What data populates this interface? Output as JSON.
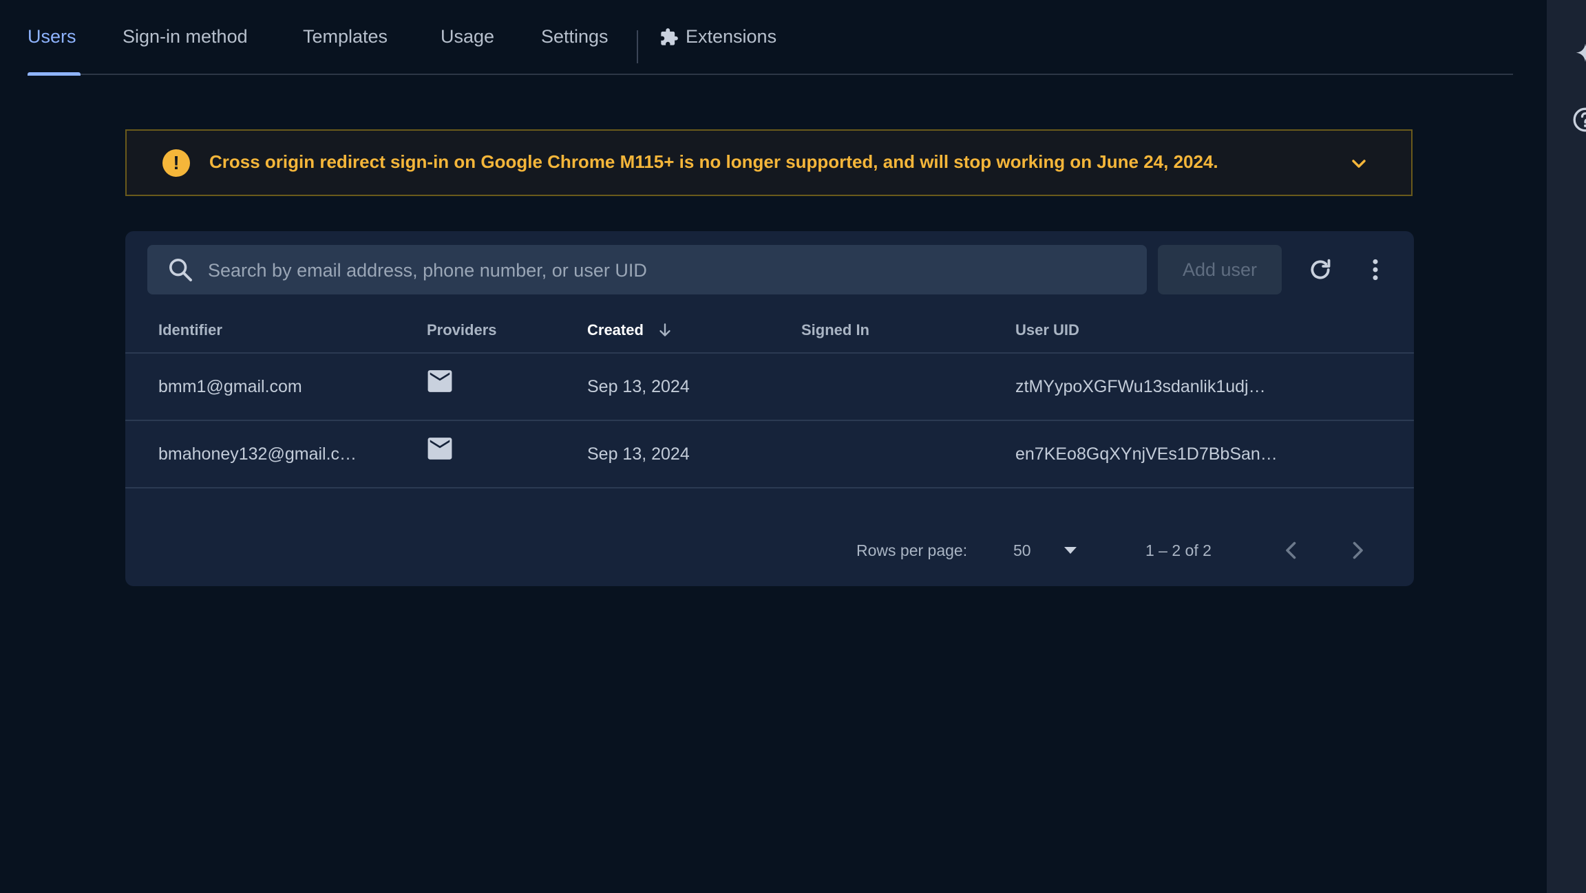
{
  "tabs": [
    {
      "label": "Users"
    },
    {
      "label": "Sign-in method"
    },
    {
      "label": "Templates"
    },
    {
      "label": "Usage"
    },
    {
      "label": "Settings"
    },
    {
      "label": "Extensions"
    }
  ],
  "banner": {
    "text": "Cross origin redirect sign-in on Google Chrome M115+ is no longer supported, and will stop working on June 24, 2024.",
    "icon_glyph": "!"
  },
  "search": {
    "placeholder": "Search by email address, phone number, or user UID"
  },
  "toolbar": {
    "add_user_label": "Add user"
  },
  "table": {
    "headers": [
      "Identifier",
      "Providers",
      "Created",
      "Signed In",
      "User UID"
    ],
    "rows": [
      {
        "identifier": "bmm1@gmail.com",
        "provider": "email-icon",
        "created": "Sep 13, 2024",
        "signed_in": "",
        "uid": "ztMYypoXGFWu13sdanlik1udj…"
      },
      {
        "identifier": "bmahoney132@gmail.c…",
        "provider": "email-icon",
        "created": "Sep 13, 2024",
        "signed_in": "",
        "uid": "en7KEo8GqXYnjVEs1D7BbSan…"
      }
    ]
  },
  "pagination": {
    "rows_per_page_label": "Rows per page:",
    "rows_per_page_value": "50",
    "range_text": "1 – 2 of 2"
  },
  "colors": {
    "accent": "#8fb4ff",
    "warning": "#f5b63a",
    "background": "#08121f",
    "card": "#16233a"
  }
}
